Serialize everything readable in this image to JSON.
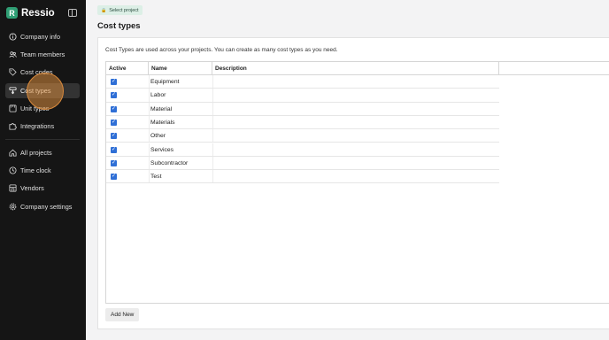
{
  "app": {
    "name": "Ressio",
    "logo_letter": "R",
    "brand_color": "#2f9e74"
  },
  "sidebar": {
    "items": [
      {
        "label": "Company info",
        "icon": "info-icon"
      },
      {
        "label": "Team members",
        "icon": "users-icon"
      },
      {
        "label": "Cost codes",
        "icon": "tag-icon"
      },
      {
        "label": "Cost types",
        "icon": "cost-type-icon",
        "active": true
      },
      {
        "label": "Unit types",
        "icon": "ruler-icon"
      },
      {
        "label": "Integrations",
        "icon": "puzzle-icon"
      }
    ],
    "items2": [
      {
        "label": "All projects",
        "icon": "home-icon"
      },
      {
        "label": "Time clock",
        "icon": "clock-icon"
      },
      {
        "label": "Vendors",
        "icon": "store-icon"
      },
      {
        "label": "Company settings",
        "icon": "gear-icon"
      }
    ]
  },
  "header": {
    "chip": "Select project",
    "title": "Cost types"
  },
  "main": {
    "description": "Cost Types are used across your projects. You can create as many cost types as you need.",
    "columns": [
      "Active",
      "Name",
      "Description"
    ],
    "rows": [
      {
        "active": true,
        "name": "Equipment",
        "description": ""
      },
      {
        "active": true,
        "name": "Labor",
        "description": ""
      },
      {
        "active": true,
        "name": "Material",
        "description": ""
      },
      {
        "active": true,
        "name": "Materials",
        "description": ""
      },
      {
        "active": true,
        "name": "Other",
        "description": ""
      },
      {
        "active": true,
        "name": "Services",
        "description": ""
      },
      {
        "active": true,
        "name": "Subcontractor",
        "description": ""
      },
      {
        "active": true,
        "name": "Test",
        "description": ""
      }
    ],
    "add_button": "Add New"
  }
}
